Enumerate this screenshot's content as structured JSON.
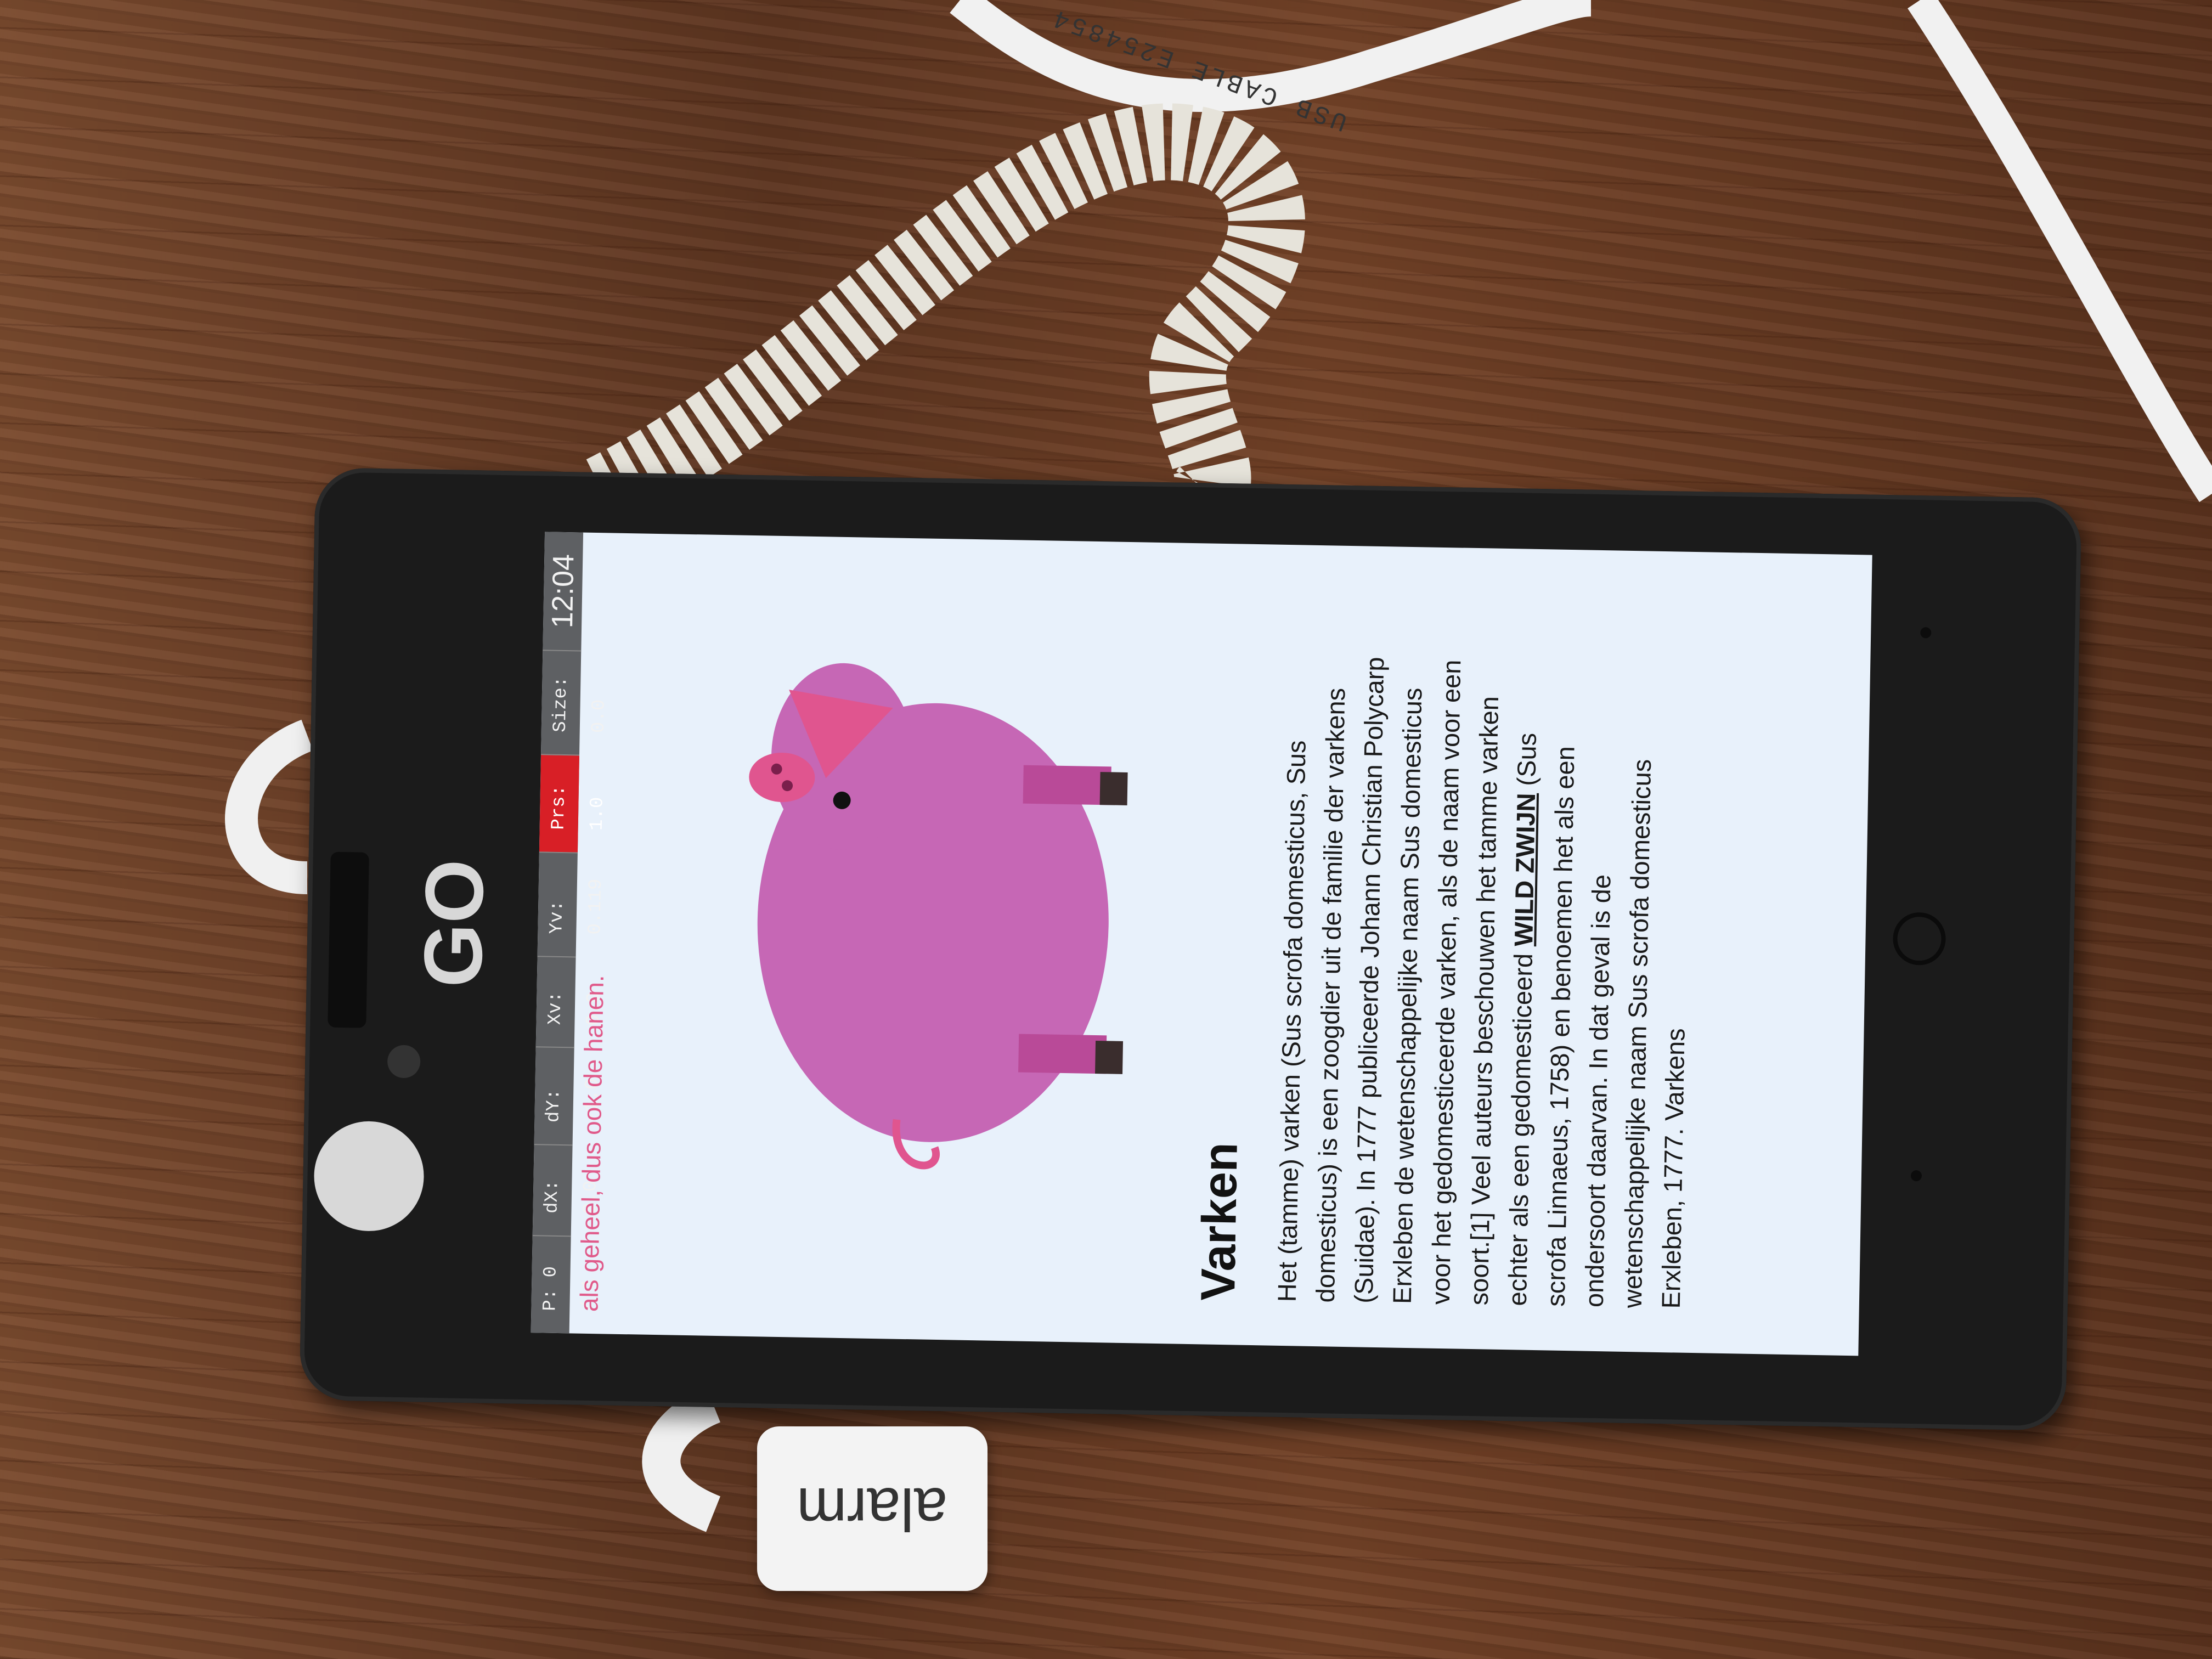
{
  "device": {
    "brand_logo": "GO",
    "alarm_label": "alarm",
    "cable_label": "USB CABLE E254854"
  },
  "debug_overlay": {
    "p": "P: 0 / 1",
    "dx": "dX: 0.0",
    "dy": "dY: -1.0",
    "xv": "Xv: 0.0",
    "yv": "Yv: 0.119",
    "prs": "Prs: 1.0",
    "size": "Size: 0.0",
    "time": "12:04"
  },
  "caption": "als geheel, dus ook de hanen.",
  "article": {
    "title": "Varken",
    "body_before_link": "Het (tamme) varken (Sus scrofa domesticus, Sus domesticus) is een zoogdier uit de familie der varkens (Suidae). In 1777 publiceerde Johann Christian Polycarp Erxleben de wetenschappelijke naam Sus domesticus voor het gedomesticeerde varken, als de naam voor een soort.[1] Veel auteurs beschouwen het tamme varken echter als een gedomesticeerd ",
    "link_text": "WILD ZWIJN",
    "body_after_link": " (Sus scrofa Linnaeus, 1758) en benoemen het als een ondersoort daarvan. In dat geval is de wetenschappelijke naam Sus scrofa domesticus Erxleben, 1777. Varkens"
  },
  "colors": {
    "pig_body": "#c667b5",
    "pig_dark": "#b94a98",
    "pig_ear": "#e0558f",
    "screen_bg": "#e8f1fb",
    "prs_bg": "#d81f26"
  }
}
